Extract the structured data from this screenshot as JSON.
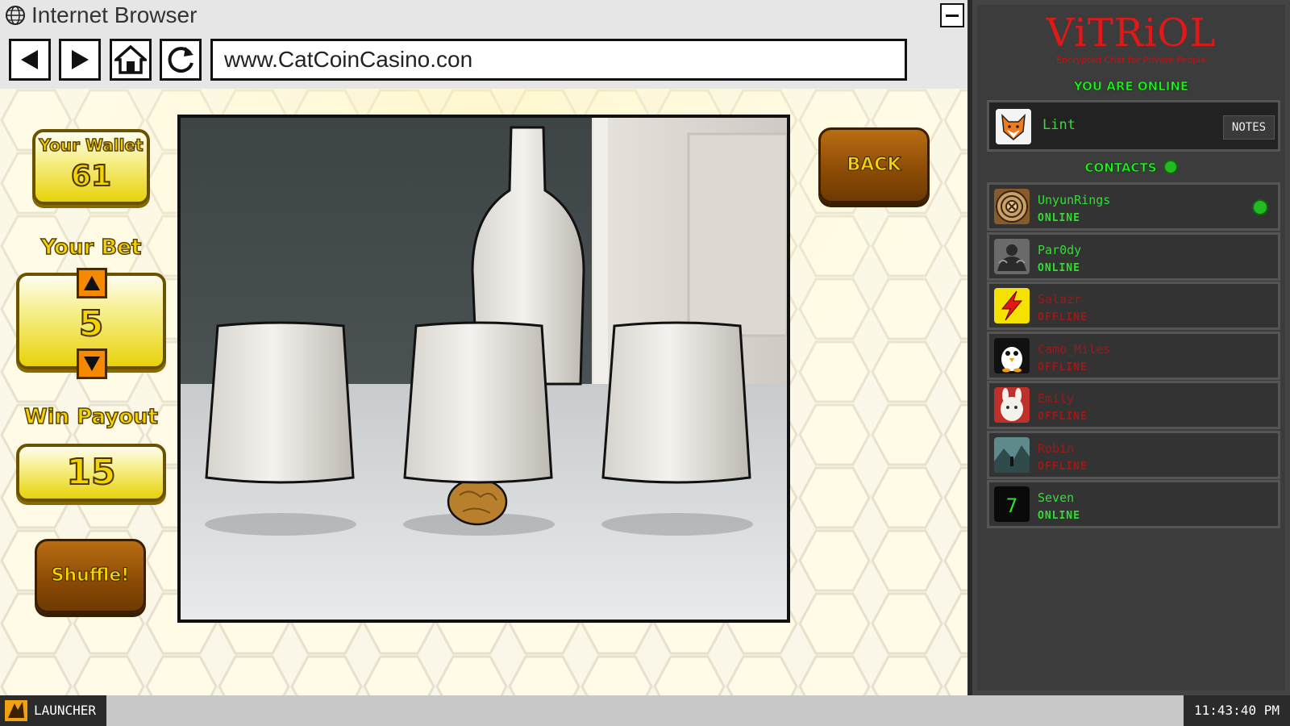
{
  "window": {
    "title": "Internet Browser"
  },
  "nav": {
    "url": "www.CatCoinCasino.con"
  },
  "game": {
    "wallet_label": "Your Wallet",
    "wallet_value": "61",
    "bet_label": "Your Bet",
    "bet_value": "5",
    "payout_label": "Win Payout",
    "payout_value": "15",
    "shuffle_label": "Shuffle!",
    "back_label": "BACK"
  },
  "chat": {
    "logo": "ViTRiOL",
    "tagline": "Encrypted Chat for Private People",
    "status": "YOU ARE ONLINE",
    "self_name": "Lint",
    "notes_label": "NOTES",
    "contacts_header": "CONTACTS",
    "contacts": [
      {
        "name": "UnyunRings",
        "status": "ONLINE",
        "online": true,
        "alert": true,
        "avatar": "target-icon"
      },
      {
        "name": "Par0dy",
        "status": "ONLINE",
        "online": true,
        "alert": false,
        "avatar": "muscle-man-avatar"
      },
      {
        "name": "Salazr",
        "status": "OFFLINE",
        "online": false,
        "alert": false,
        "avatar": "lightning-icon"
      },
      {
        "name": "Camo_Miles",
        "status": "OFFLINE",
        "online": false,
        "alert": false,
        "avatar": "penguin-avatar"
      },
      {
        "name": "Emily",
        "status": "OFFLINE",
        "online": false,
        "alert": false,
        "avatar": "bunny-avatar"
      },
      {
        "name": "Robin",
        "status": "OFFLINE",
        "online": false,
        "alert": false,
        "avatar": "landscape-avatar"
      },
      {
        "name": "Seven",
        "status": "ONLINE",
        "online": true,
        "alert": false,
        "avatar": "seven-avatar"
      }
    ]
  },
  "taskbar": {
    "launcher_label": "LAUNCHER",
    "clock": "11:43:40 PM"
  },
  "colors": {
    "online": "#33dd33",
    "offline": "#a01818",
    "logo": "#e01818",
    "gold": "#f4d400"
  }
}
